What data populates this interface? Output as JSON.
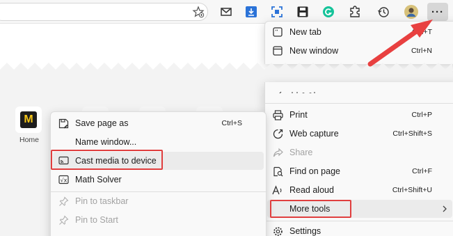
{
  "toolbar": {
    "icons": [
      "favorite-star-icon",
      "mail-icon",
      "download-icon",
      "screenshot-icon",
      "save-icon",
      "grammarly-icon",
      "extensions-icon",
      "history-icon",
      "profile-avatar",
      "more-icon"
    ],
    "more_label": "···"
  },
  "new_tab_page": {
    "tile_logo": "M",
    "tile_label": "Home"
  },
  "main_menu": {
    "items": [
      {
        "label": "New tab",
        "shortcut": "Ctrl+T",
        "icon": "new-tab-icon"
      },
      {
        "label": "New window",
        "shortcut": "Ctrl+N",
        "icon": "new-window-icon"
      },
      {
        "label": "Print",
        "shortcut": "Ctrl+P",
        "icon": "print-icon"
      },
      {
        "label": "Web capture",
        "shortcut": "Ctrl+Shift+S",
        "icon": "web-capture-icon"
      },
      {
        "label": "Share",
        "shortcut": "",
        "icon": "share-icon",
        "disabled": true
      },
      {
        "label": "Find on page",
        "shortcut": "Ctrl+F",
        "icon": "find-icon"
      },
      {
        "label": "Read aloud",
        "shortcut": "Ctrl+Shift+U",
        "icon": "read-aloud-icon"
      },
      {
        "label": "More tools",
        "shortcut": "",
        "icon": "",
        "submenu": true,
        "highlighted": true
      },
      {
        "label": "Settings",
        "shortcut": "",
        "icon": "settings-icon"
      }
    ]
  },
  "more_tools_menu": {
    "items": [
      {
        "label": "Save page as",
        "shortcut": "Ctrl+S",
        "icon": "save-page-icon"
      },
      {
        "label": "Name window...",
        "shortcut": "",
        "icon": ""
      },
      {
        "label": "Cast media to device",
        "shortcut": "",
        "icon": "cast-icon",
        "highlighted": true
      },
      {
        "label": "Math Solver",
        "shortcut": "",
        "icon": "math-solver-icon"
      },
      {
        "label": "Pin to taskbar",
        "shortcut": "",
        "icon": "pin-icon",
        "disabled": true
      },
      {
        "label": "Pin to Start",
        "shortcut": "",
        "icon": "pin-icon",
        "disabled": true
      }
    ]
  },
  "colors": {
    "annotation_red": "#e03e3e",
    "menu_bg": "#f9f9f9",
    "highlight_bg": "#ebebeb"
  }
}
